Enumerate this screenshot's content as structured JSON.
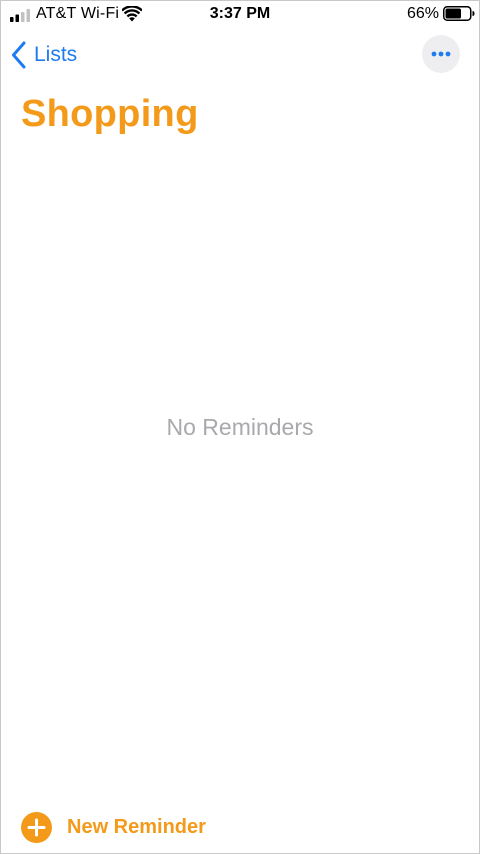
{
  "status_bar": {
    "carrier": "AT&T Wi-Fi",
    "time": "3:37 PM",
    "battery_percent": "66%",
    "battery_level": 0.66
  },
  "nav": {
    "back_label": "Lists",
    "back_icon": "chevron-left-icon",
    "more_icon": "ellipsis-icon"
  },
  "list": {
    "title": "Shopping",
    "empty_message": "No Reminders"
  },
  "toolbar": {
    "new_reminder_label": "New Reminder",
    "new_reminder_icon": "plus-circle-icon"
  },
  "colors": {
    "accent": "#f49a1b",
    "link": "#1e7cf2",
    "empty_text": "#a9a9ad",
    "more_button_bg": "#eeeef0"
  }
}
